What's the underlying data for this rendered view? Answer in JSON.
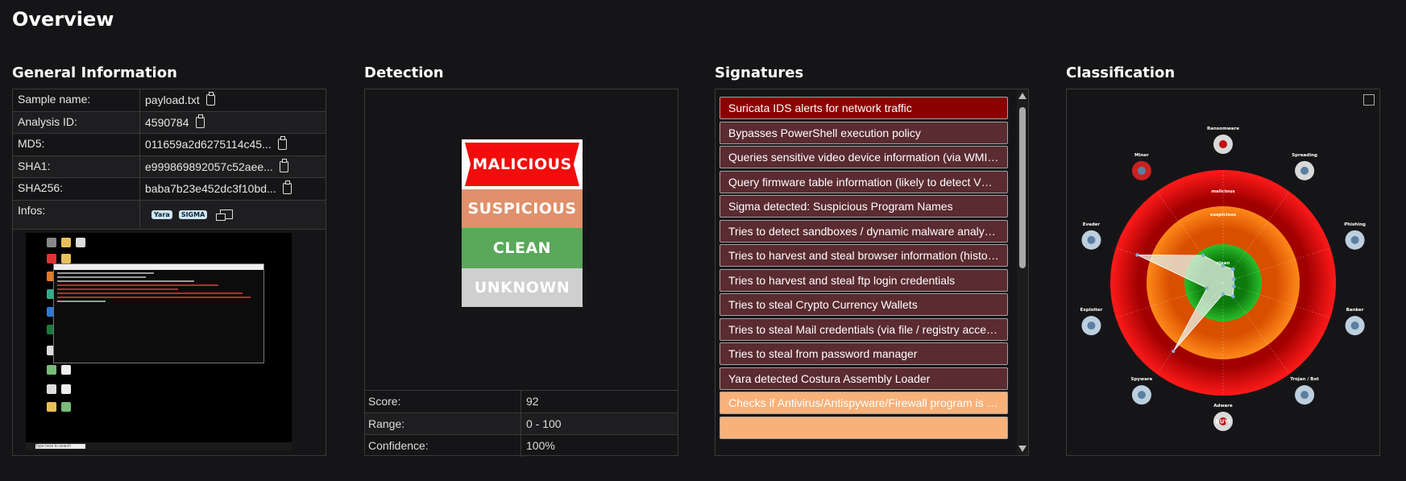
{
  "page": {
    "title": "Overview"
  },
  "general": {
    "title": "General Information",
    "rows": [
      {
        "key": "Sample name:",
        "value": "payload.txt",
        "copy": true
      },
      {
        "key": "Analysis ID:",
        "value": "4590784",
        "copy": true
      },
      {
        "key": "MD5:",
        "value": "011659a2d6275114c45...",
        "copy": true
      },
      {
        "key": "SHA1:",
        "value": "e999869892057c52aee...",
        "copy": true
      },
      {
        "key": "SHA256:",
        "value": "baba7b23e452dc3f10bd...",
        "copy": true
      },
      {
        "key": "Infos:",
        "value": ""
      }
    ],
    "info_tags": [
      "Yara",
      "SIGMA"
    ],
    "screenshot_search_text": "Type here to search"
  },
  "detection": {
    "title": "Detection",
    "verdicts": [
      "MALICIOUS",
      "SUSPICIOUS",
      "CLEAN",
      "UNKNOWN"
    ],
    "selected": "MALICIOUS",
    "stats": [
      {
        "key": "Score:",
        "value": "92"
      },
      {
        "key": "Range:",
        "value": "0 - 100"
      },
      {
        "key": "Confidence:",
        "value": "100%"
      }
    ]
  },
  "signatures": {
    "title": "Signatures",
    "items": [
      {
        "text": "Suricata IDS alerts for network traffic",
        "severity": "red"
      },
      {
        "text": "Bypasses PowerShell execution policy",
        "severity": "normal"
      },
      {
        "text": "Queries sensitive video device information (via WMI, Wi...",
        "severity": "normal"
      },
      {
        "text": "Query firmware table information (likely to detect VMs)",
        "severity": "normal"
      },
      {
        "text": "Sigma detected: Suspicious Program Names",
        "severity": "normal"
      },
      {
        "text": "Tries to detect sandboxes / dynamic malware analysis s...",
        "severity": "normal"
      },
      {
        "text": "Tries to harvest and steal browser information (history, ...",
        "severity": "normal"
      },
      {
        "text": "Tries to harvest and steal ftp login credentials",
        "severity": "normal"
      },
      {
        "text": "Tries to steal Crypto Currency Wallets",
        "severity": "normal"
      },
      {
        "text": "Tries to steal Mail credentials (via file / registry access)",
        "severity": "normal"
      },
      {
        "text": "Tries to steal from password manager",
        "severity": "normal"
      },
      {
        "text": "Yara detected Costura Assembly Loader",
        "severity": "normal"
      },
      {
        "text": "Checks if Antivirus/Antispyware/Firewall program is inst...",
        "severity": "orange"
      },
      {
        "text": "",
        "severity": "orange"
      }
    ]
  },
  "classification": {
    "title": "Classification",
    "rings": [
      "malicious",
      "suspicious",
      "clean"
    ],
    "categories": [
      "Ransomware",
      "Spreading",
      "Phishing",
      "Banker",
      "Trojan / Bot",
      "Adware",
      "Spyware",
      "Exploiter",
      "Evader",
      "Miner"
    ],
    "scores": [
      0.15,
      0.15,
      0.1,
      0.1,
      0.15,
      0.1,
      0.75,
      0.15,
      0.8,
      0.3
    ],
    "adware_badge": "BUY!",
    "colors": {
      "malicious": "#e00000",
      "suspicious": "#ff7a10",
      "clean": "#1aa51a"
    }
  }
}
